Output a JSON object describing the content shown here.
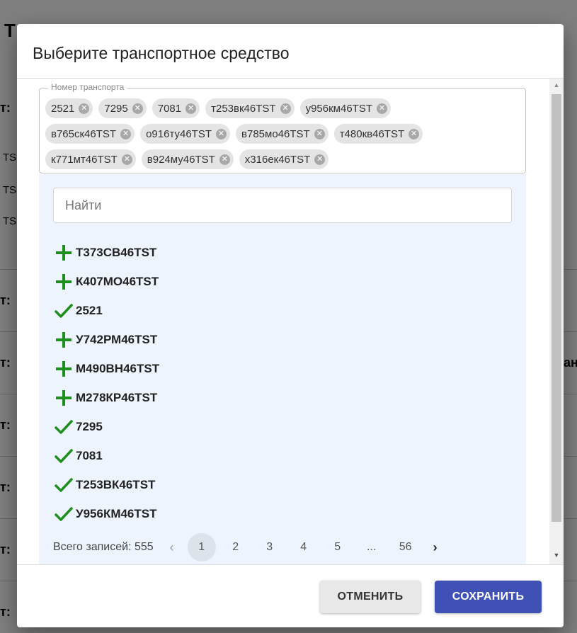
{
  "background": {
    "letters": [
      "Т",
      "т:",
      "TS",
      "TS",
      "TS",
      "т:",
      "т:",
      "т:",
      "т:",
      "т:",
      "т:"
    ],
    "right_fragment": "ан"
  },
  "dialog": {
    "title": "Выберите транспортное средство",
    "field_label": "Номер транспорта",
    "selected_chips": [
      [
        "2521",
        "7295",
        "7081",
        "т253вк46TST",
        "у956км46TST"
      ],
      [
        "в765ск46TST",
        "о916ту46TST",
        "в785мо46TST",
        "т480кв46TST"
      ],
      [
        "к771мт46TST",
        "в924му46TST",
        "х316ек46TST"
      ]
    ],
    "search_placeholder": "Найти",
    "vehicles": [
      {
        "label": "Т373СВ46TST",
        "status": "add",
        "icon": "plus-icon"
      },
      {
        "label": "К407МО46TST",
        "status": "add",
        "icon": "plus-icon"
      },
      {
        "label": "2521",
        "status": "selected",
        "icon": "check-icon"
      },
      {
        "label": "У742РМ46TST",
        "status": "add",
        "icon": "plus-icon"
      },
      {
        "label": "М490ВН46TST",
        "status": "add",
        "icon": "plus-icon"
      },
      {
        "label": "М278КР46TST",
        "status": "add",
        "icon": "plus-icon"
      },
      {
        "label": "7295",
        "status": "selected",
        "icon": "check-icon"
      },
      {
        "label": "7081",
        "status": "selected",
        "icon": "check-icon"
      },
      {
        "label": "Т253ВК46TST",
        "status": "selected",
        "icon": "check-icon"
      },
      {
        "label": "У956КМ46TST",
        "status": "selected",
        "icon": "check-icon"
      }
    ],
    "pagination": {
      "total_label": "Всего записей: 555",
      "prev": "‹",
      "pages": [
        "1",
        "2",
        "3",
        "4",
        "5",
        "...",
        "56"
      ],
      "current": "1",
      "next": "›"
    },
    "cancel_label": "ОТМЕНИТЬ",
    "save_label": "СОХРАНИТЬ"
  },
  "colors": {
    "icon_green": "#1e8e1e",
    "save_button": "#3f51b5",
    "panel_bg": "#eef4fd"
  }
}
